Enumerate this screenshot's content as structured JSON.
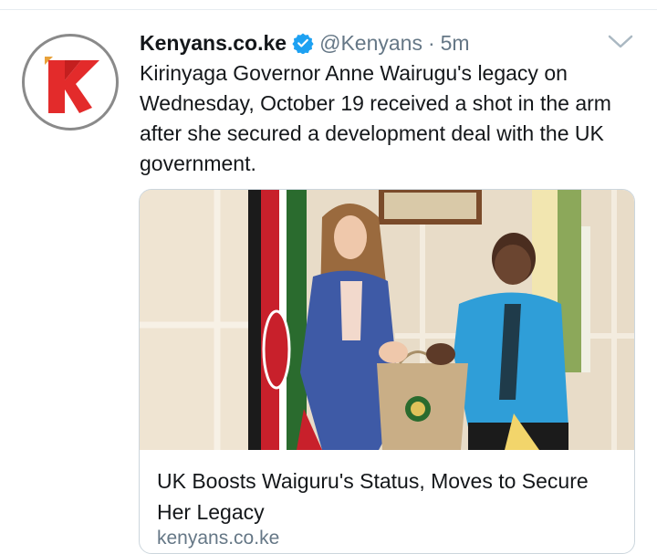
{
  "tweet": {
    "display_name": "Kenyans.co.ke",
    "handle": "@Kenyans",
    "separator": "·",
    "time": "5m",
    "text": "Kirinyaga Governor Anne Wairugu's legacy on Wednesday, October 19 received a shot in the arm after she secured a development deal with the UK government.",
    "avatar_icon": "kenyans-logo-icon",
    "verified_icon": "verified-badge-icon",
    "menu_icon": "chevron-down-icon"
  },
  "card": {
    "title": "UK Boosts Waiguru's Status, Moves to Secure Her Legacy",
    "domain": "kenyans.co.ke",
    "image_description_icon": "news-photo"
  },
  "colors": {
    "brand_red": "#e32b2b",
    "verified_blue": "#1da1f2",
    "secondary_text": "#657786",
    "border": "#ccd6dd"
  }
}
